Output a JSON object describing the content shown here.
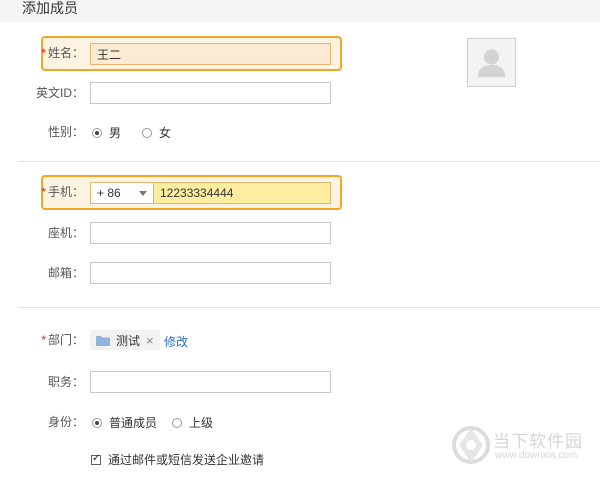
{
  "header": {
    "title": "添加成员"
  },
  "form": {
    "name": {
      "label": "姓名：",
      "required_mark": "*",
      "value": "王二"
    },
    "english_id": {
      "label": "英文ID：",
      "value": ""
    },
    "gender": {
      "label": "性别：",
      "options": [
        "男",
        "女"
      ],
      "selected": "男"
    },
    "mobile": {
      "label": "手机：",
      "required_mark": "*",
      "country_code": "+ 86",
      "value": "12233334444"
    },
    "landline": {
      "label": "座机：",
      "value": ""
    },
    "email": {
      "label": "邮箱：",
      "value": ""
    },
    "department": {
      "label": "部门：",
      "required_mark": "*",
      "tag": "测试",
      "remove_symbol": "×",
      "edit_link": "修改"
    },
    "position": {
      "label": "职务：",
      "value": ""
    },
    "identity": {
      "label": "身份：",
      "options": [
        "普通成员",
        "上级"
      ],
      "selected": "普通成员"
    },
    "invite": {
      "label": "通过邮件或短信发送企业邀请",
      "checked": true
    }
  },
  "watermark": {
    "brand": "当下软件园",
    "url": "www.downxia.com"
  },
  "colors": {
    "highlight_border": "#f5a623",
    "link": "#2a6fc9",
    "required": "#e02020"
  }
}
